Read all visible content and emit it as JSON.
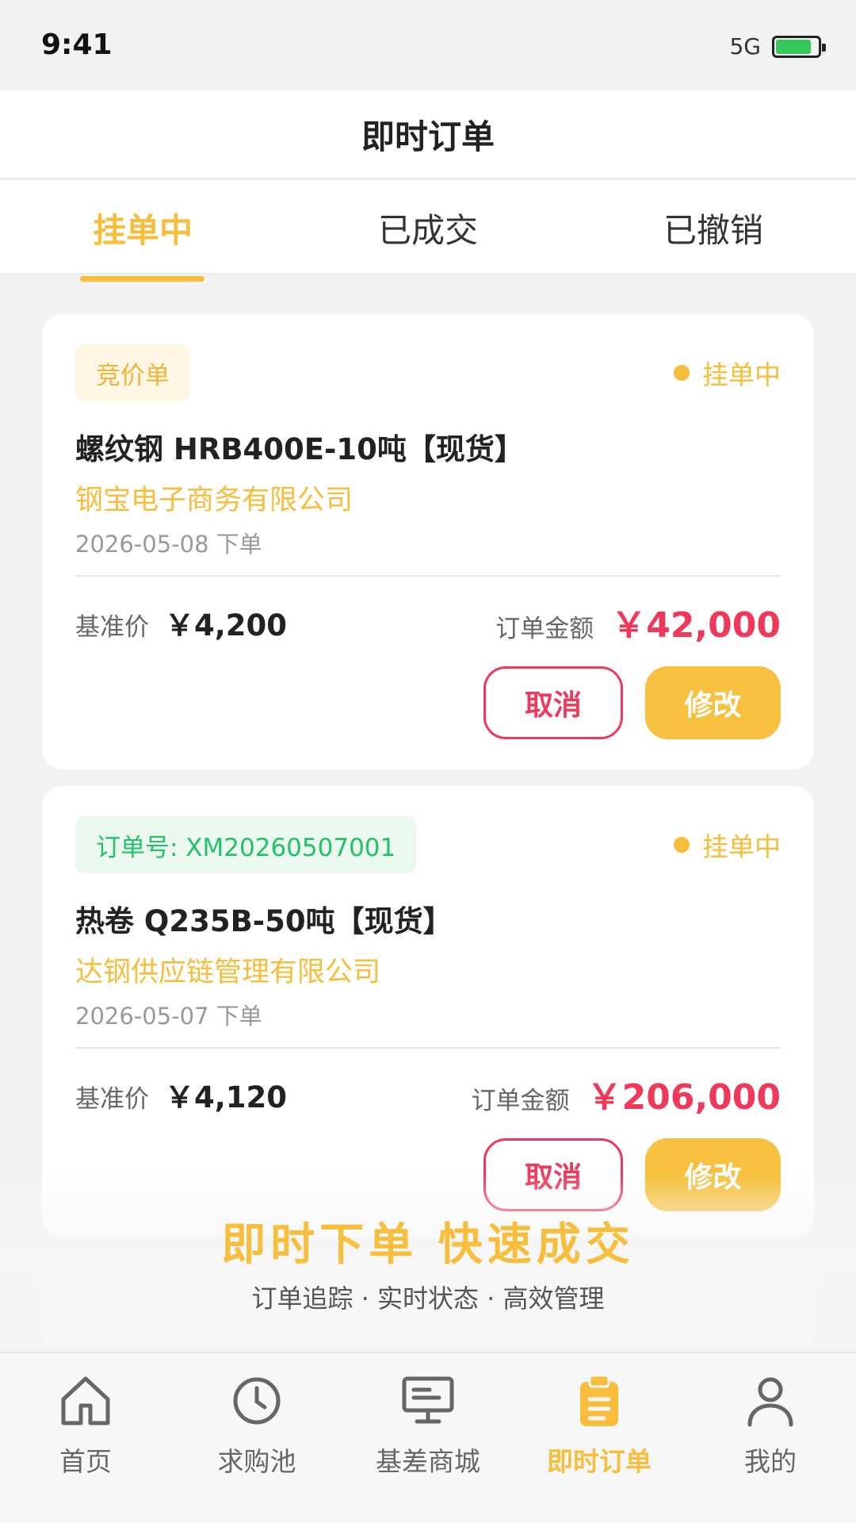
{
  "status_bar": {
    "time": "9:41",
    "network": "5G"
  },
  "header": {
    "title": "即时订单"
  },
  "tabs": [
    {
      "label": "挂单中",
      "active": true
    },
    {
      "label": "已成交",
      "active": false
    },
    {
      "label": "已撤销",
      "active": false
    }
  ],
  "orders": [
    {
      "badge": "竞价单",
      "status": "挂单中",
      "product": "螺纹钢 HRB400E-10吨【现货】",
      "company": "钢宝电子商务有限公司",
      "date": "2026-05-08 下单",
      "base_price_label": "基准价",
      "base_price": "￥4,200",
      "amount_label": "订单金额",
      "amount": "￥42,000",
      "cancel_label": "取消",
      "edit_label": "修改"
    },
    {
      "badge": "订单号: XM20260507001",
      "status": "挂单中",
      "product": "热卷 Q235B-50吨【现货】",
      "company": "达钢供应链管理有限公司",
      "date": "2026-05-07 下单",
      "base_price_label": "基准价",
      "base_price": "￥4,120",
      "amount_label": "订单金额",
      "amount": "￥206,000",
      "cancel_label": "取消",
      "edit_label": "修改"
    }
  ],
  "promo": {
    "title": "即时下单 快速成交",
    "subtitle": "订单追踪 · 实时状态 · 高效管理"
  },
  "bottom_nav": [
    {
      "label": "首页",
      "icon": "home-icon",
      "active": false
    },
    {
      "label": "求购池",
      "icon": "clock-icon",
      "active": false
    },
    {
      "label": "基差商城",
      "icon": "monitor-icon",
      "active": false
    },
    {
      "label": "即时订单",
      "icon": "clipboard-icon",
      "active": true
    },
    {
      "label": "我的",
      "icon": "user-icon",
      "active": false
    }
  ],
  "colors": {
    "accent": "#f7bd3b",
    "price": "#f0385a",
    "order_badge": "#25c06a",
    "battery": "#34c759"
  }
}
